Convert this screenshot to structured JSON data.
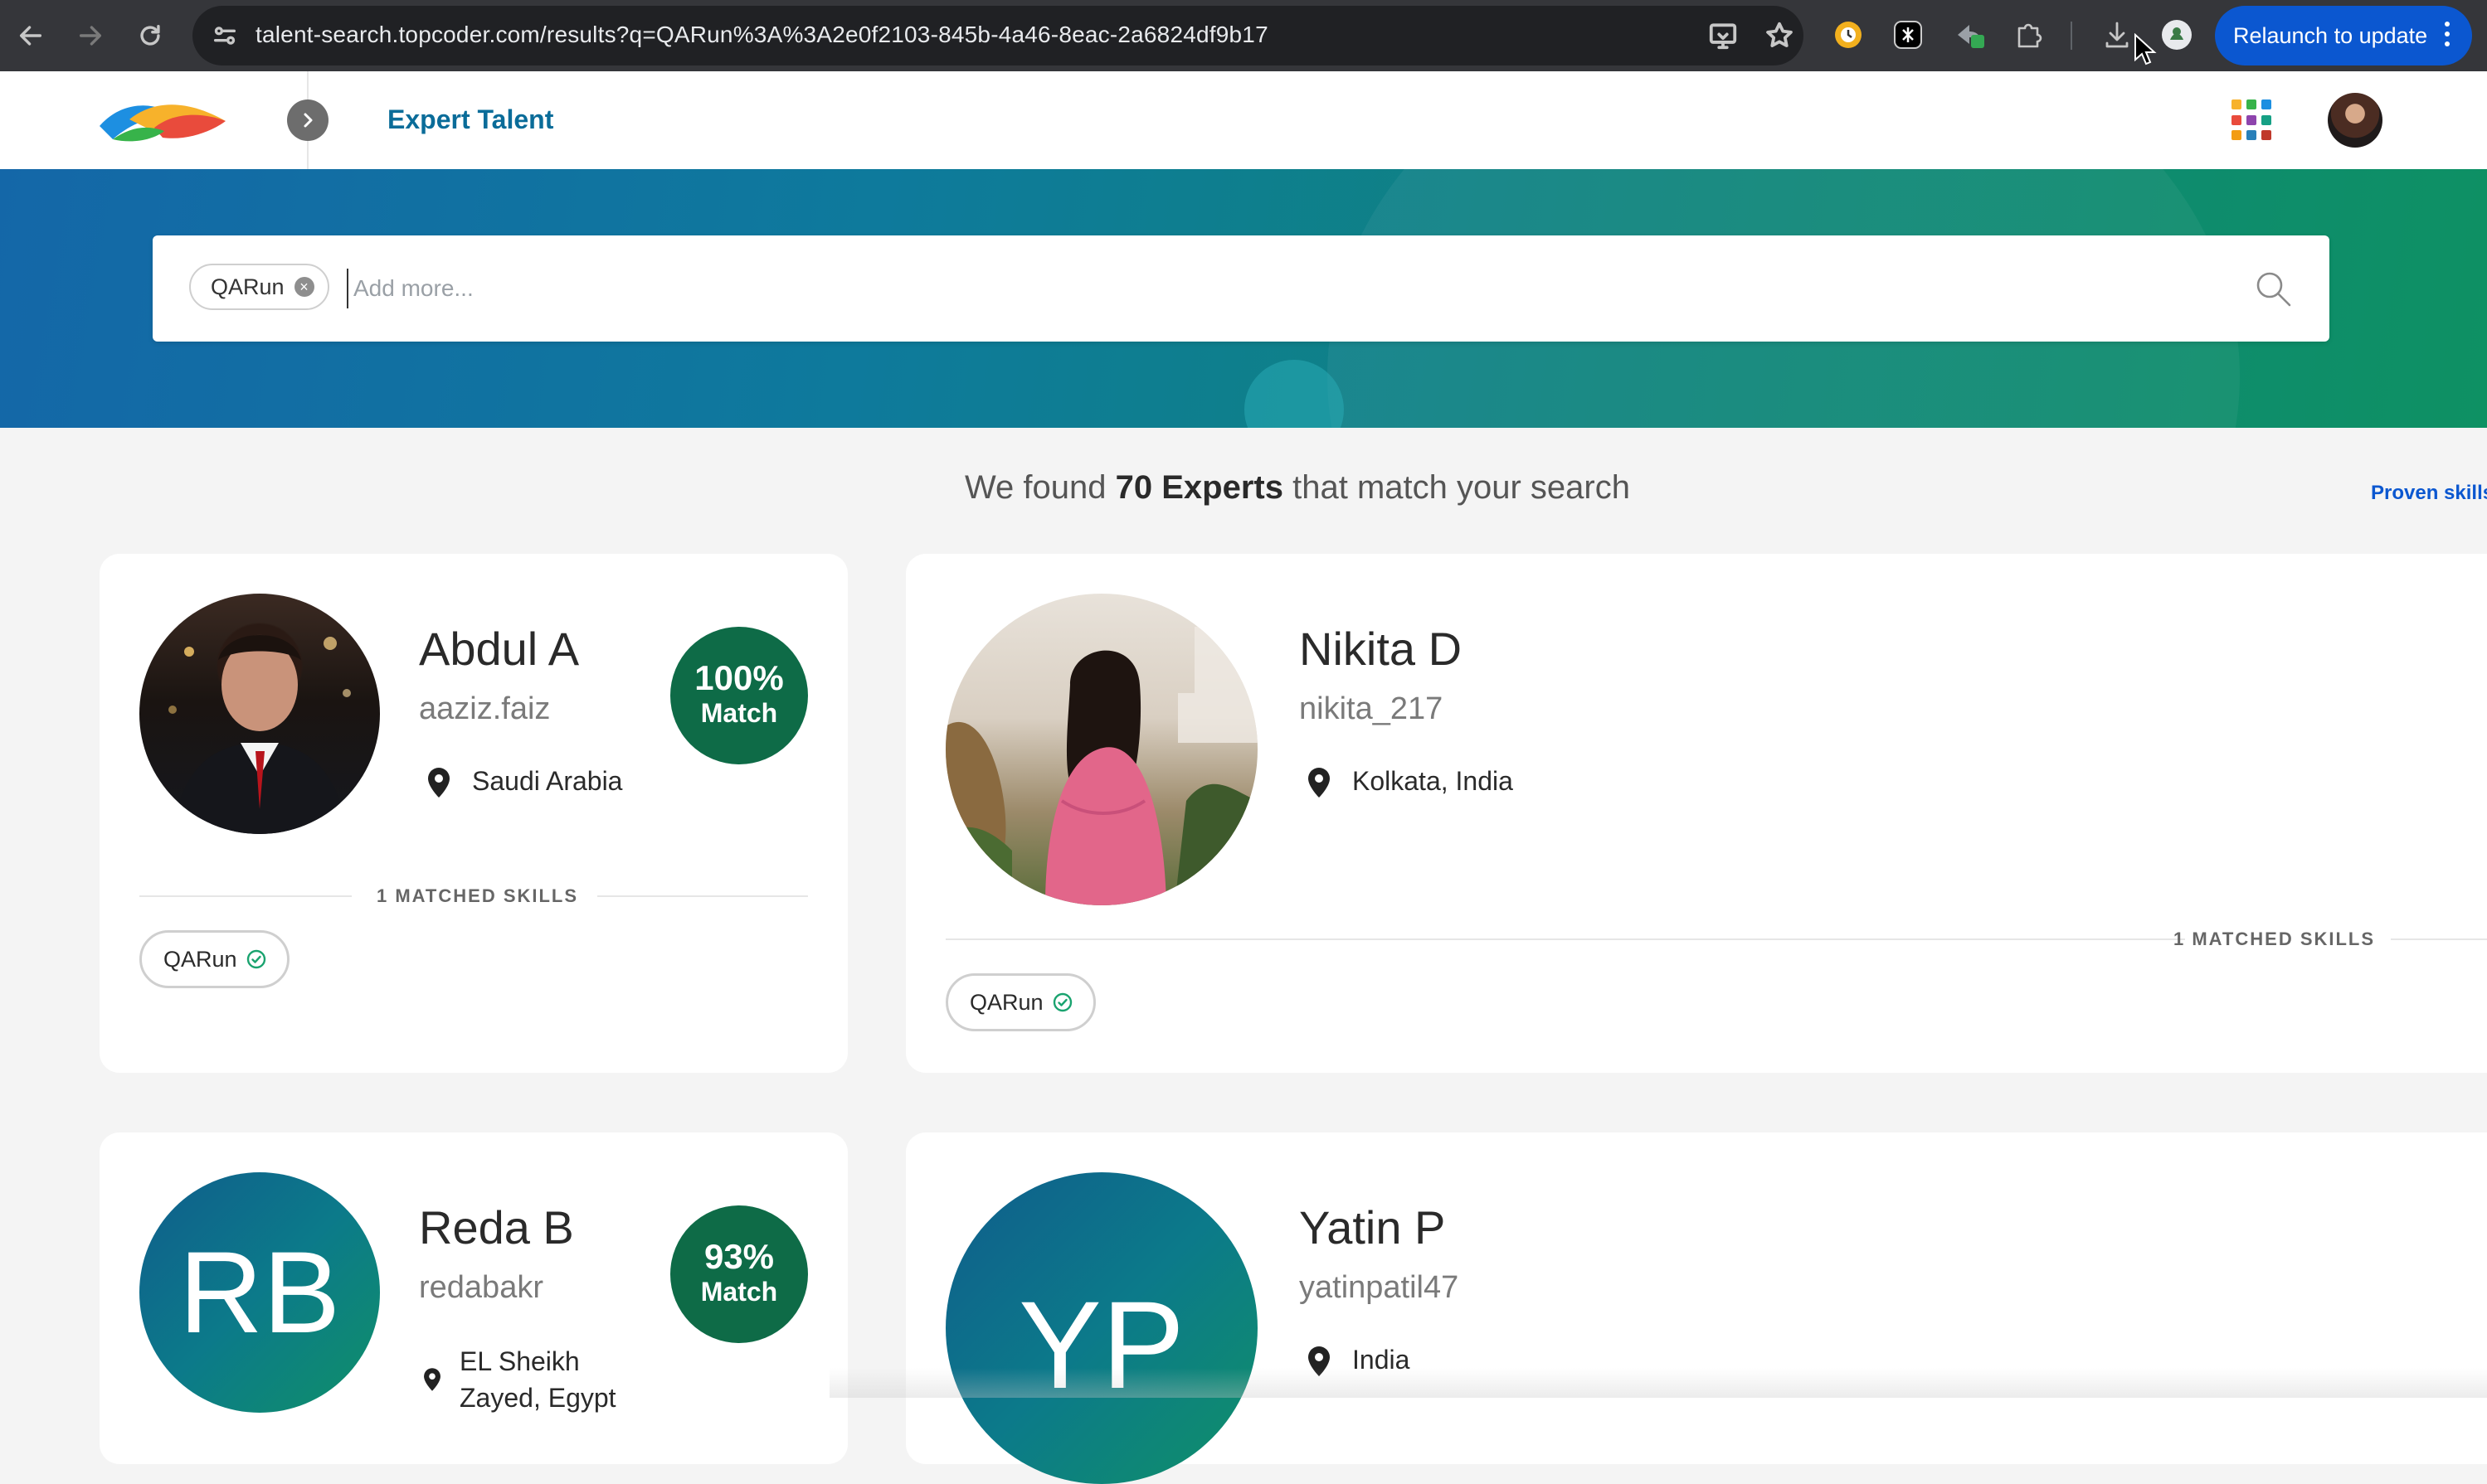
{
  "browser": {
    "url": "talent-search.topcoder.com/results?q=QARun%3A%3A2e0f2103-845b-4a46-8eac-2a6824df9b17",
    "relaunch_label": "Relaunch to update",
    "icons": [
      "back-arrow-icon",
      "forward-arrow-icon",
      "reload-icon",
      "site-settings-icon",
      "cast-icon",
      "bookmark-star-icon",
      "extension-icons",
      "puzzle-icon",
      "download-icon",
      "profile-icon",
      "kebab-menu-icon"
    ]
  },
  "header": {
    "app_title": "Expert Talent"
  },
  "search": {
    "chips": [
      {
        "label": "QARun"
      }
    ],
    "placeholder": "Add more..."
  },
  "results": {
    "prefix": "We found",
    "count": "70 Experts",
    "suffix": "that match your search",
    "proven_link": "Proven skills"
  },
  "experts": [
    {
      "name": "Abdul A",
      "handle": "aaziz.faiz",
      "location": "Saudi Arabia",
      "match_pct": "100%",
      "match_label": "Match",
      "skills_label": "1 MATCHED SKILLS",
      "skills": [
        "QARun"
      ]
    },
    {
      "name": "Nikita D",
      "handle": "nikita_217",
      "location": "Kolkata, India",
      "skills_label": "1 MATCHED SKILLS",
      "skills": [
        "QARun"
      ]
    },
    {
      "name": "Reda B",
      "initials": "RB",
      "handle": "redabakr",
      "location_line1": "EL Sheikh",
      "location_line2": "Zayed, Egypt",
      "match_pct": "93%",
      "match_label": "Match"
    },
    {
      "name": "Yatin P",
      "initials": "YP",
      "handle": "yatinpatil47",
      "location": "India"
    }
  ],
  "colors": {
    "chrome_bg": "#35363a",
    "omnibox_bg": "#202124",
    "relaunch_blue": "#0b57d0",
    "brand_title": "#0a6c99",
    "match_green": "#0e6b47",
    "banner_start": "#1467a8",
    "banner_end": "#0e9163"
  }
}
